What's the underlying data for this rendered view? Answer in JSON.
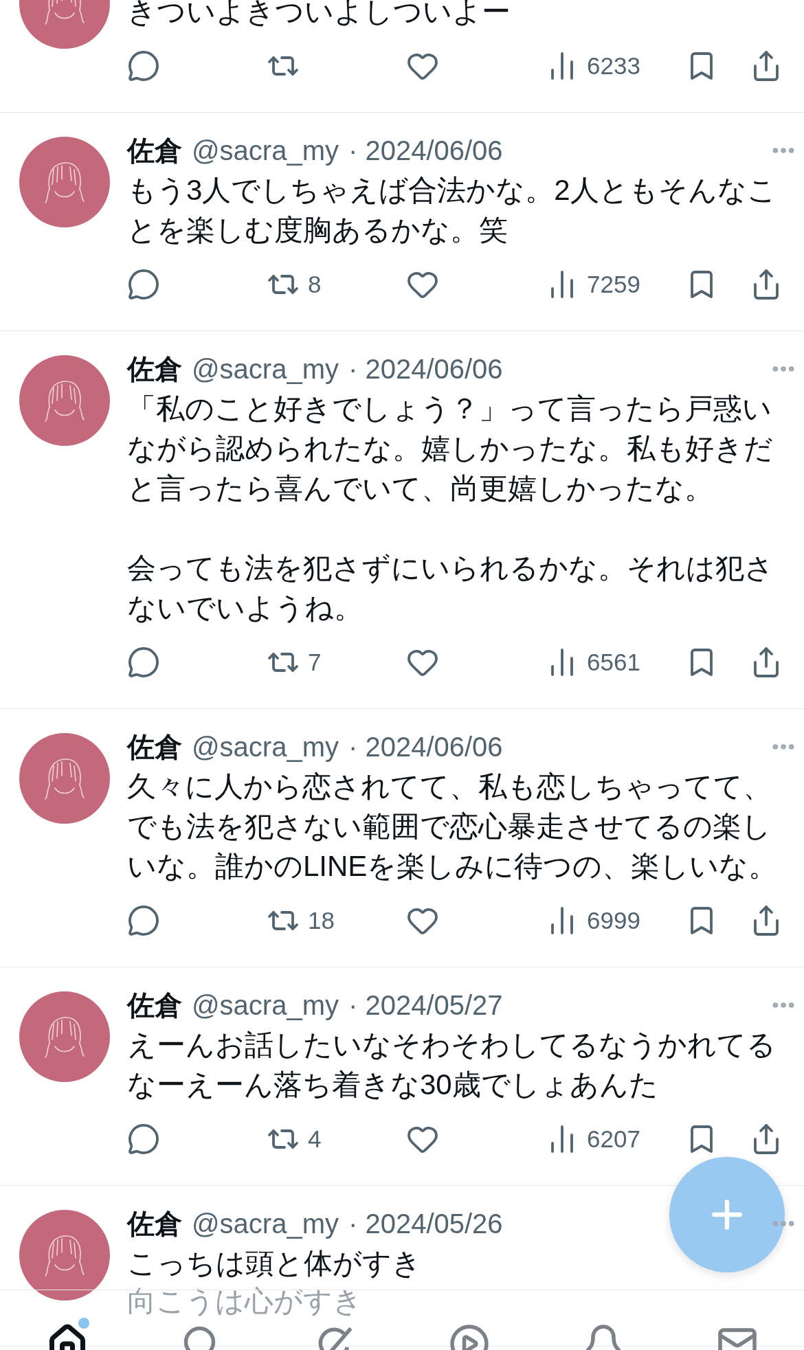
{
  "timeline": [
    {
      "paragraphs": [
        "きついよきついよしついよー"
      ],
      "views": "6233"
    },
    {
      "name": "佐倉",
      "handle": "@sacra_my",
      "date": "· 2024/06/06",
      "paragraphs": [
        "もう3人でしちゃえば合法かな。2人ともそんなことを楽しむ度胸あるかな。笑"
      ],
      "retweets": "8",
      "views": "7259"
    },
    {
      "name": "佐倉",
      "handle": "@sacra_my",
      "date": "· 2024/06/06",
      "paragraphs": [
        "「私のこと好きでしょう？」って言ったら戸惑いながら認められたな。嬉しかったな。私も好きだと言ったら喜んでいて、尚更嬉しかったな。",
        "会っても法を犯さずにいられるかな。それは犯さないでいようね。"
      ],
      "retweets": "7",
      "views": "6561"
    },
    {
      "name": "佐倉",
      "handle": "@sacra_my",
      "date": "· 2024/06/06",
      "paragraphs": [
        "久々に人から恋されてて、私も恋しちゃってて、でも法を犯さない範囲で恋心暴走させてるの楽しいな。誰かのLINEを楽しみに待つの、楽しいな。"
      ],
      "retweets": "18",
      "views": "6999"
    },
    {
      "name": "佐倉",
      "handle": "@sacra_my",
      "date": "· 2024/05/27",
      "paragraphs": [
        "えーんお話したいなそわそわしてるなうかれてるなーえーん落ち着きな30歳でしょあんた"
      ],
      "retweets": "4",
      "views": "6207"
    },
    {
      "name": "佐倉",
      "handle": "@sacra_my",
      "date": "· 2024/05/26",
      "paragraphs": [
        "こっちは頭と体がすき"
      ],
      "faded_line": "向こうは心がすき"
    }
  ],
  "tab_bar": [
    {
      "selected": true,
      "badge": true
    },
    {
      "selected": false,
      "badge": false
    },
    {
      "selected": false,
      "badge": false
    },
    {
      "selected": false,
      "badge": false
    },
    {
      "selected": false,
      "badge": false
    },
    {
      "selected": false,
      "badge": false
    }
  ]
}
